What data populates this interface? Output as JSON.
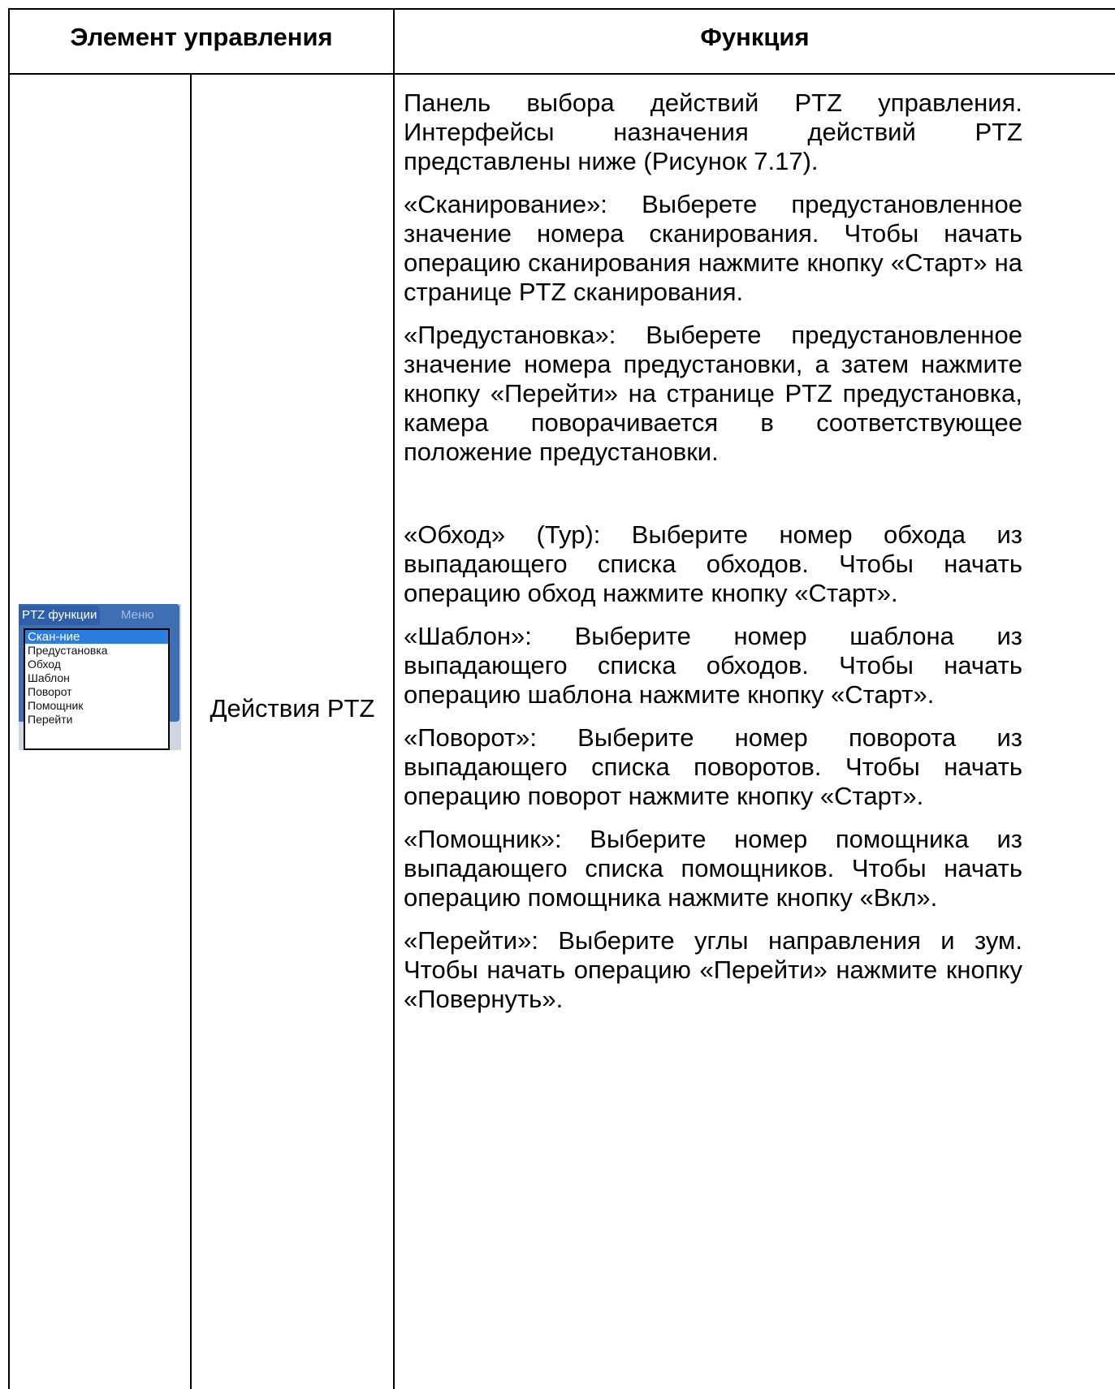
{
  "header": {
    "control": "Элемент управления",
    "function": "Функция"
  },
  "row": {
    "control_label": "Действия PTZ",
    "widget": {
      "tab_active": "PTZ функции",
      "tab_menu": "Меню",
      "items": [
        "Скан-ние",
        "Предустановка",
        "Обход",
        "Шаблон",
        "Поворот",
        "Помощник",
        "Перейти"
      ],
      "selected": "Скан-ние"
    },
    "paragraphs": [
      "Панель выбора действий PTZ управления. Интерфейсы назначения действий PTZ представлены ниже (Рисунок 7.17).",
      "«Сканирование»: Выберете предустановленное значение номера сканирования. Чтобы начать операцию сканирования нажмите кнопку «Старт» на странице PTZ сканирования.",
      "«Предустановка»: Выберете предустановленное значение номера предустановки, а затем нажмите кнопку «Перейти» на странице PTZ предустановка, камера поворачивается в соответствующее положение предустановки.",
      "«Обход» (Тур): Выберите номер обхода из выпадающего списка обходов. Чтобы начать операцию обход нажмите кнопку «Старт».",
      "«Шаблон»: Выберите номер шаблона из выпадающего списка обходов. Чтобы начать операцию шаблона нажмите кнопку «Старт».",
      "«Поворот»: Выберите номер поворота из выпадающего списка поворотов. Чтобы начать операцию поворот нажмите кнопку «Старт».",
      "«Помощник»: Выберите номер помощника из выпадающего списка помощников. Чтобы начать операцию помощника нажмите кнопку «Вкл».",
      "«Перейти»: Выберите углы направления и зум. Чтобы начать операцию «Перейти» нажмите кнопку «Повернуть»."
    ]
  }
}
